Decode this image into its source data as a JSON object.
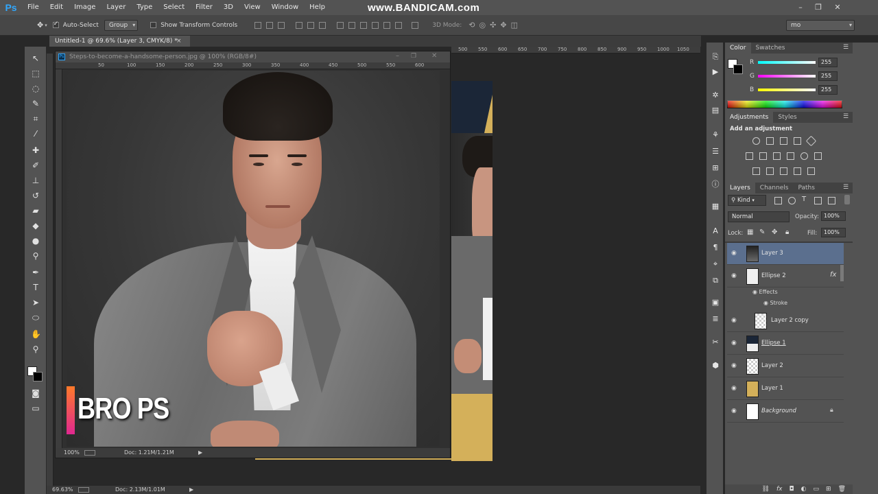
{
  "app": {
    "logo": "Ps",
    "watermark": "www.BANDICAM.com"
  },
  "menu": [
    "File",
    "Edit",
    "Image",
    "Layer",
    "Type",
    "Select",
    "Filter",
    "3D",
    "View",
    "Window",
    "Help"
  ],
  "window_controls": {
    "minimize": "–",
    "maximize": "❐",
    "close": "✕"
  },
  "options_bar": {
    "auto_select_label": "Auto-Select",
    "auto_select_value": "Group",
    "transform_controls_label": "Show Transform Controls",
    "mode_3d_label": "3D Mode:",
    "workspace_value": "mo"
  },
  "document": {
    "tab_title": "Untitled-1 @ 69.6% (Layer 3, CMYK/8) *",
    "tab_close": "×",
    "ruler_top": [
      "500",
      "550",
      "600",
      "650",
      "700",
      "750",
      "800",
      "850",
      "900",
      "950",
      "1000",
      "1050"
    ],
    "zoom": "69.63%",
    "doc_size": "Doc: 2.13M/1.01M"
  },
  "floating_doc": {
    "title": "Steps-to-become-a-handsome-person.jpg @ 100% (RGB/8#)",
    "ruler_top": [
      "50",
      "100",
      "150",
      "200",
      "250",
      "300",
      "350",
      "400",
      "450",
      "500",
      "550",
      "600"
    ],
    "zoom": "100%",
    "doc_size": "Doc: 1.21M/1.21M",
    "overlay_text": "BRO PS",
    "overlay_gradient": [
      "#ff7a2a",
      "#e0288f"
    ]
  },
  "color_panel": {
    "tabs": [
      "Color",
      "Swatches"
    ],
    "channels": [
      {
        "label": "R",
        "value": "255"
      },
      {
        "label": "G",
        "value": "255"
      },
      {
        "label": "B",
        "value": "255"
      }
    ]
  },
  "adjustments_panel": {
    "tabs": [
      "Adjustments",
      "Styles"
    ],
    "heading": "Add an adjustment"
  },
  "layers_panel": {
    "tabs": [
      "Layers",
      "Channels",
      "Paths"
    ],
    "kind_label": "Kind",
    "blend_mode": "Normal",
    "opacity_label": "Opacity:",
    "opacity_value": "100%",
    "lock_label": "Lock:",
    "fill_label": "Fill:",
    "fill_value": "100%",
    "fx_label": "fx",
    "effects_label": "Effects",
    "stroke_label": "Stroke",
    "layers": [
      {
        "name": "Layer 3",
        "selected": true
      },
      {
        "name": "Ellipse 2"
      },
      {
        "name": "Layer 2 copy"
      },
      {
        "name": "Ellipse 1"
      },
      {
        "name": "Layer 2"
      },
      {
        "name": "Layer 1"
      },
      {
        "name": "Background"
      }
    ],
    "layer1_color": "#d4b05a"
  },
  "colors": {
    "accent_blue": "#31a8ff",
    "selected_row": "#5b6f8e",
    "panel": "#535353"
  }
}
